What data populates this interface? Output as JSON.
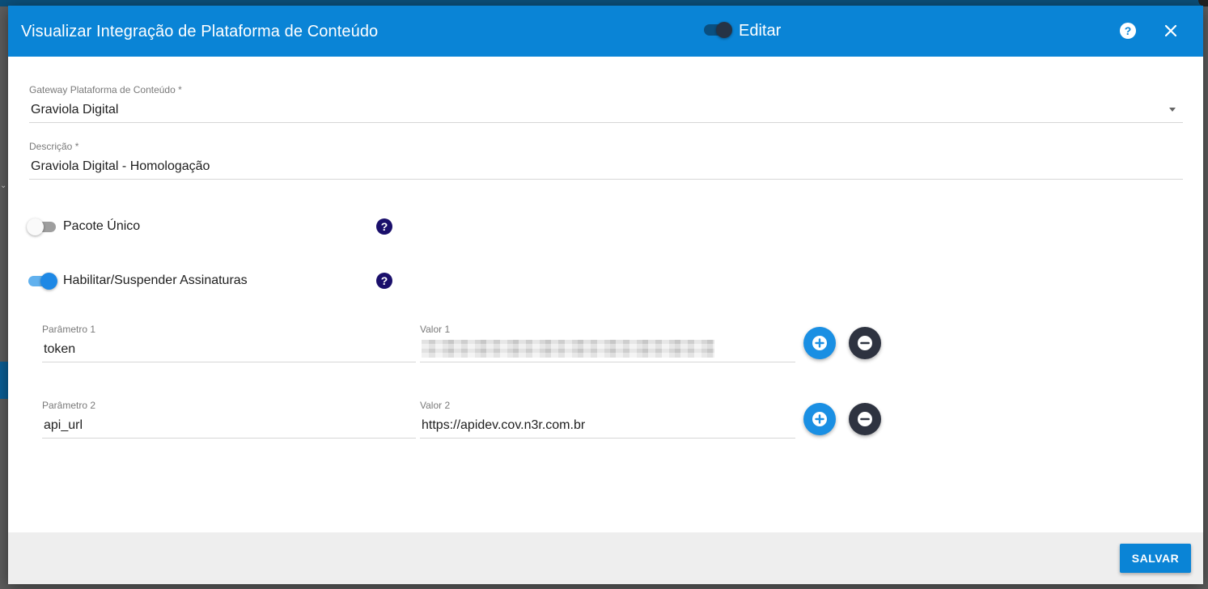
{
  "dialog": {
    "title": "Visualizar Integração de Plataforma de Conteúdo",
    "edit_toggle": {
      "label": "Editar",
      "on": true
    },
    "header_icons": [
      "help-icon",
      "close-icon"
    ],
    "accent_color": "#0a84d6"
  },
  "form": {
    "gateway": {
      "label": "Gateway Plataforma de Conteúdo",
      "required_mark": "*",
      "value": "Graviola Digital"
    },
    "description": {
      "label": "Descrição",
      "required_mark": "*",
      "value": "Graviola Digital - Homologação"
    },
    "pacote_unico": {
      "label": "Pacote Único",
      "on": false
    },
    "habilitar_assinaturas": {
      "label": "Habilitar/Suspender Assinaturas",
      "on": true
    },
    "parameters": [
      {
        "param_label": "Parâmetro 1",
        "param_value": "token",
        "value_label": "Valor 1",
        "value_value": ""
      },
      {
        "param_label": "Parâmetro 2",
        "param_value": "api_url",
        "value_label": "Valor 2",
        "value_value": "https://apidev.cov.n3r.com.br"
      }
    ]
  },
  "footer": {
    "save_label": "SALVAR"
  }
}
